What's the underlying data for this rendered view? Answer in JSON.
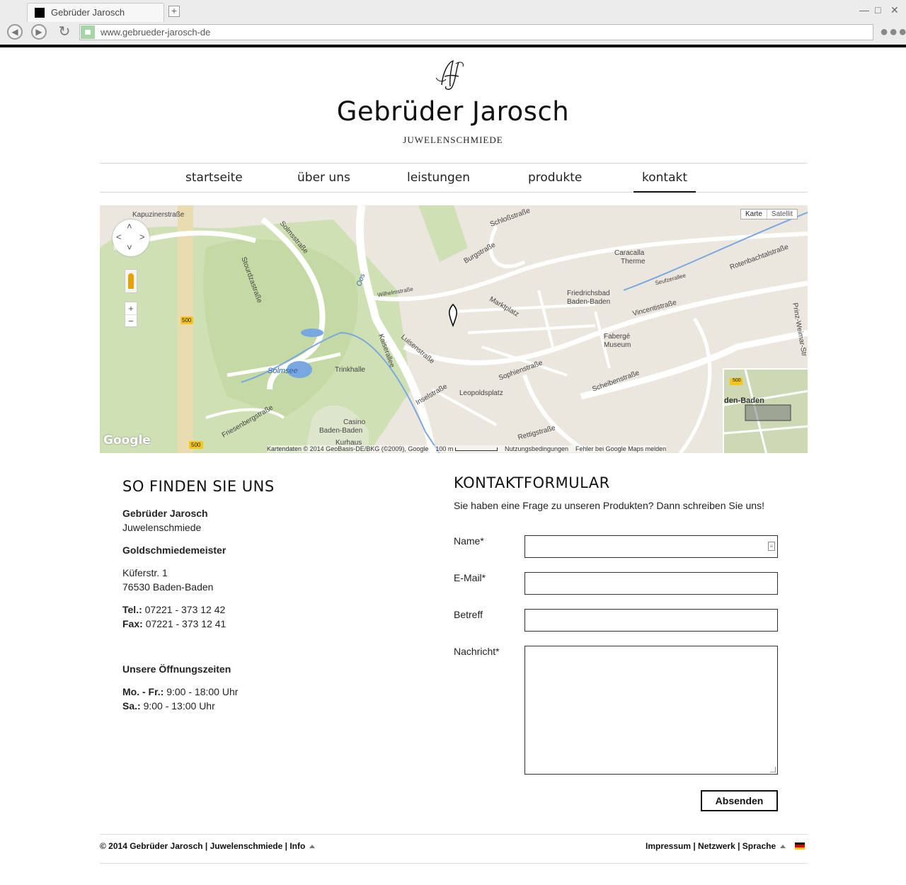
{
  "browser": {
    "tab_title": "Gebrüder Jarosch",
    "new_tab": "+",
    "url": "www.gebrueder-jarosch-de"
  },
  "site": {
    "title": "Gebrüder Jarosch",
    "subtitle": "JUWELENSCHMIEDE",
    "logo_text": "AJ"
  },
  "nav": {
    "items": [
      "startseite",
      "über uns",
      "leistungen",
      "produkte",
      "kontakt"
    ],
    "active": "kontakt"
  },
  "map": {
    "type_buttons": [
      "Karte",
      "Satellit"
    ],
    "zoom_in": "+",
    "zoom_out": "−",
    "labels": {
      "kapuziner": "Kapuzinerstraße",
      "solms": "Solmsstraße",
      "stourdza": "Stourdzastraße",
      "solmsee": "Solmsee",
      "trinkhalle": "Trinkhalle",
      "luisen": "Luisenstraße",
      "kaiserallee": "Kaiserallee",
      "inselstr": "Inselstraße",
      "leopoldsplatz": "Leopoldsplatz",
      "casino": "Casino",
      "baden": "Baden-Baden",
      "kurhaus": "Kurhaus",
      "friedrichsbad": "Friedrichsbad",
      "friedrichsbad2": "Baden-Baden",
      "caracalla": "Caracalla",
      "therme": "Therme",
      "faberge": "Fabergé",
      "museum": "Museum",
      "vincenti": "Vincentistraße",
      "sophien": "Sophienstraße",
      "scheiben": "Scheibenstraße",
      "rotenbach": "Rotenbachtalstraße",
      "marktplatz": "Marktplatz",
      "schloss": "Schloßstraße",
      "burg": "Burgstraße",
      "rettig": "Rettigstraße",
      "friesenberg": "Friesenbergstraße",
      "prinz": "Prinz-Weimar-Str",
      "seufzer": "Seufzerallee",
      "wilhelm": "Wilhelmstraße",
      "oos": "Oos",
      "route": "500",
      "overview_city": "den-Baden"
    },
    "google_logo": "Google",
    "attribution": "Kartendaten © 2014 GeoBasis-DE/BKG (©2009), Google",
    "scale": "100 m",
    "terms": "Nutzungsbedingungen",
    "report": "Fehler bei Google Maps melden"
  },
  "info": {
    "heading": "SO FINDEN SIE UNS",
    "company": "Gebrüder Jarosch",
    "company_sub": "Juwelenschmiede",
    "title": "Goldschmiedemeister",
    "street": "Küferstr. 1",
    "city": "76530 Baden-Baden",
    "tel_label": "Tel.:",
    "tel": "07221 - 373 12 42",
    "fax_label": "Fax:",
    "fax": "07221 - 373 12 41",
    "hours_heading": "Unsere Öffnungszeiten",
    "weekdays_label": "Mo. - Fr.:",
    "weekdays": "9:00 - 18:00 Uhr",
    "sat_label": "Sa.:",
    "sat": "9:00 - 13:00 Uhr"
  },
  "form": {
    "heading": "KONTAKTFORMULAR",
    "intro": "Sie haben eine Frage zu unseren Produkten? Dann schreiben Sie uns!",
    "name_label": "Name*",
    "email_label": "E-Mail*",
    "subject_label": "Betreff",
    "message_label": "Nachricht*",
    "submit": "Absenden"
  },
  "footer": {
    "left": "© 2014 Gebrüder Jarosch | Juwelenschmiede | Info",
    "right": "Impressum | Netzwerk | Sprache"
  },
  "colors": {
    "text": "#111111",
    "map_land": "#ebe7df",
    "map_park": "#cfe0b4",
    "map_water": "#79a8e0",
    "route_badge": "#f5c518"
  }
}
